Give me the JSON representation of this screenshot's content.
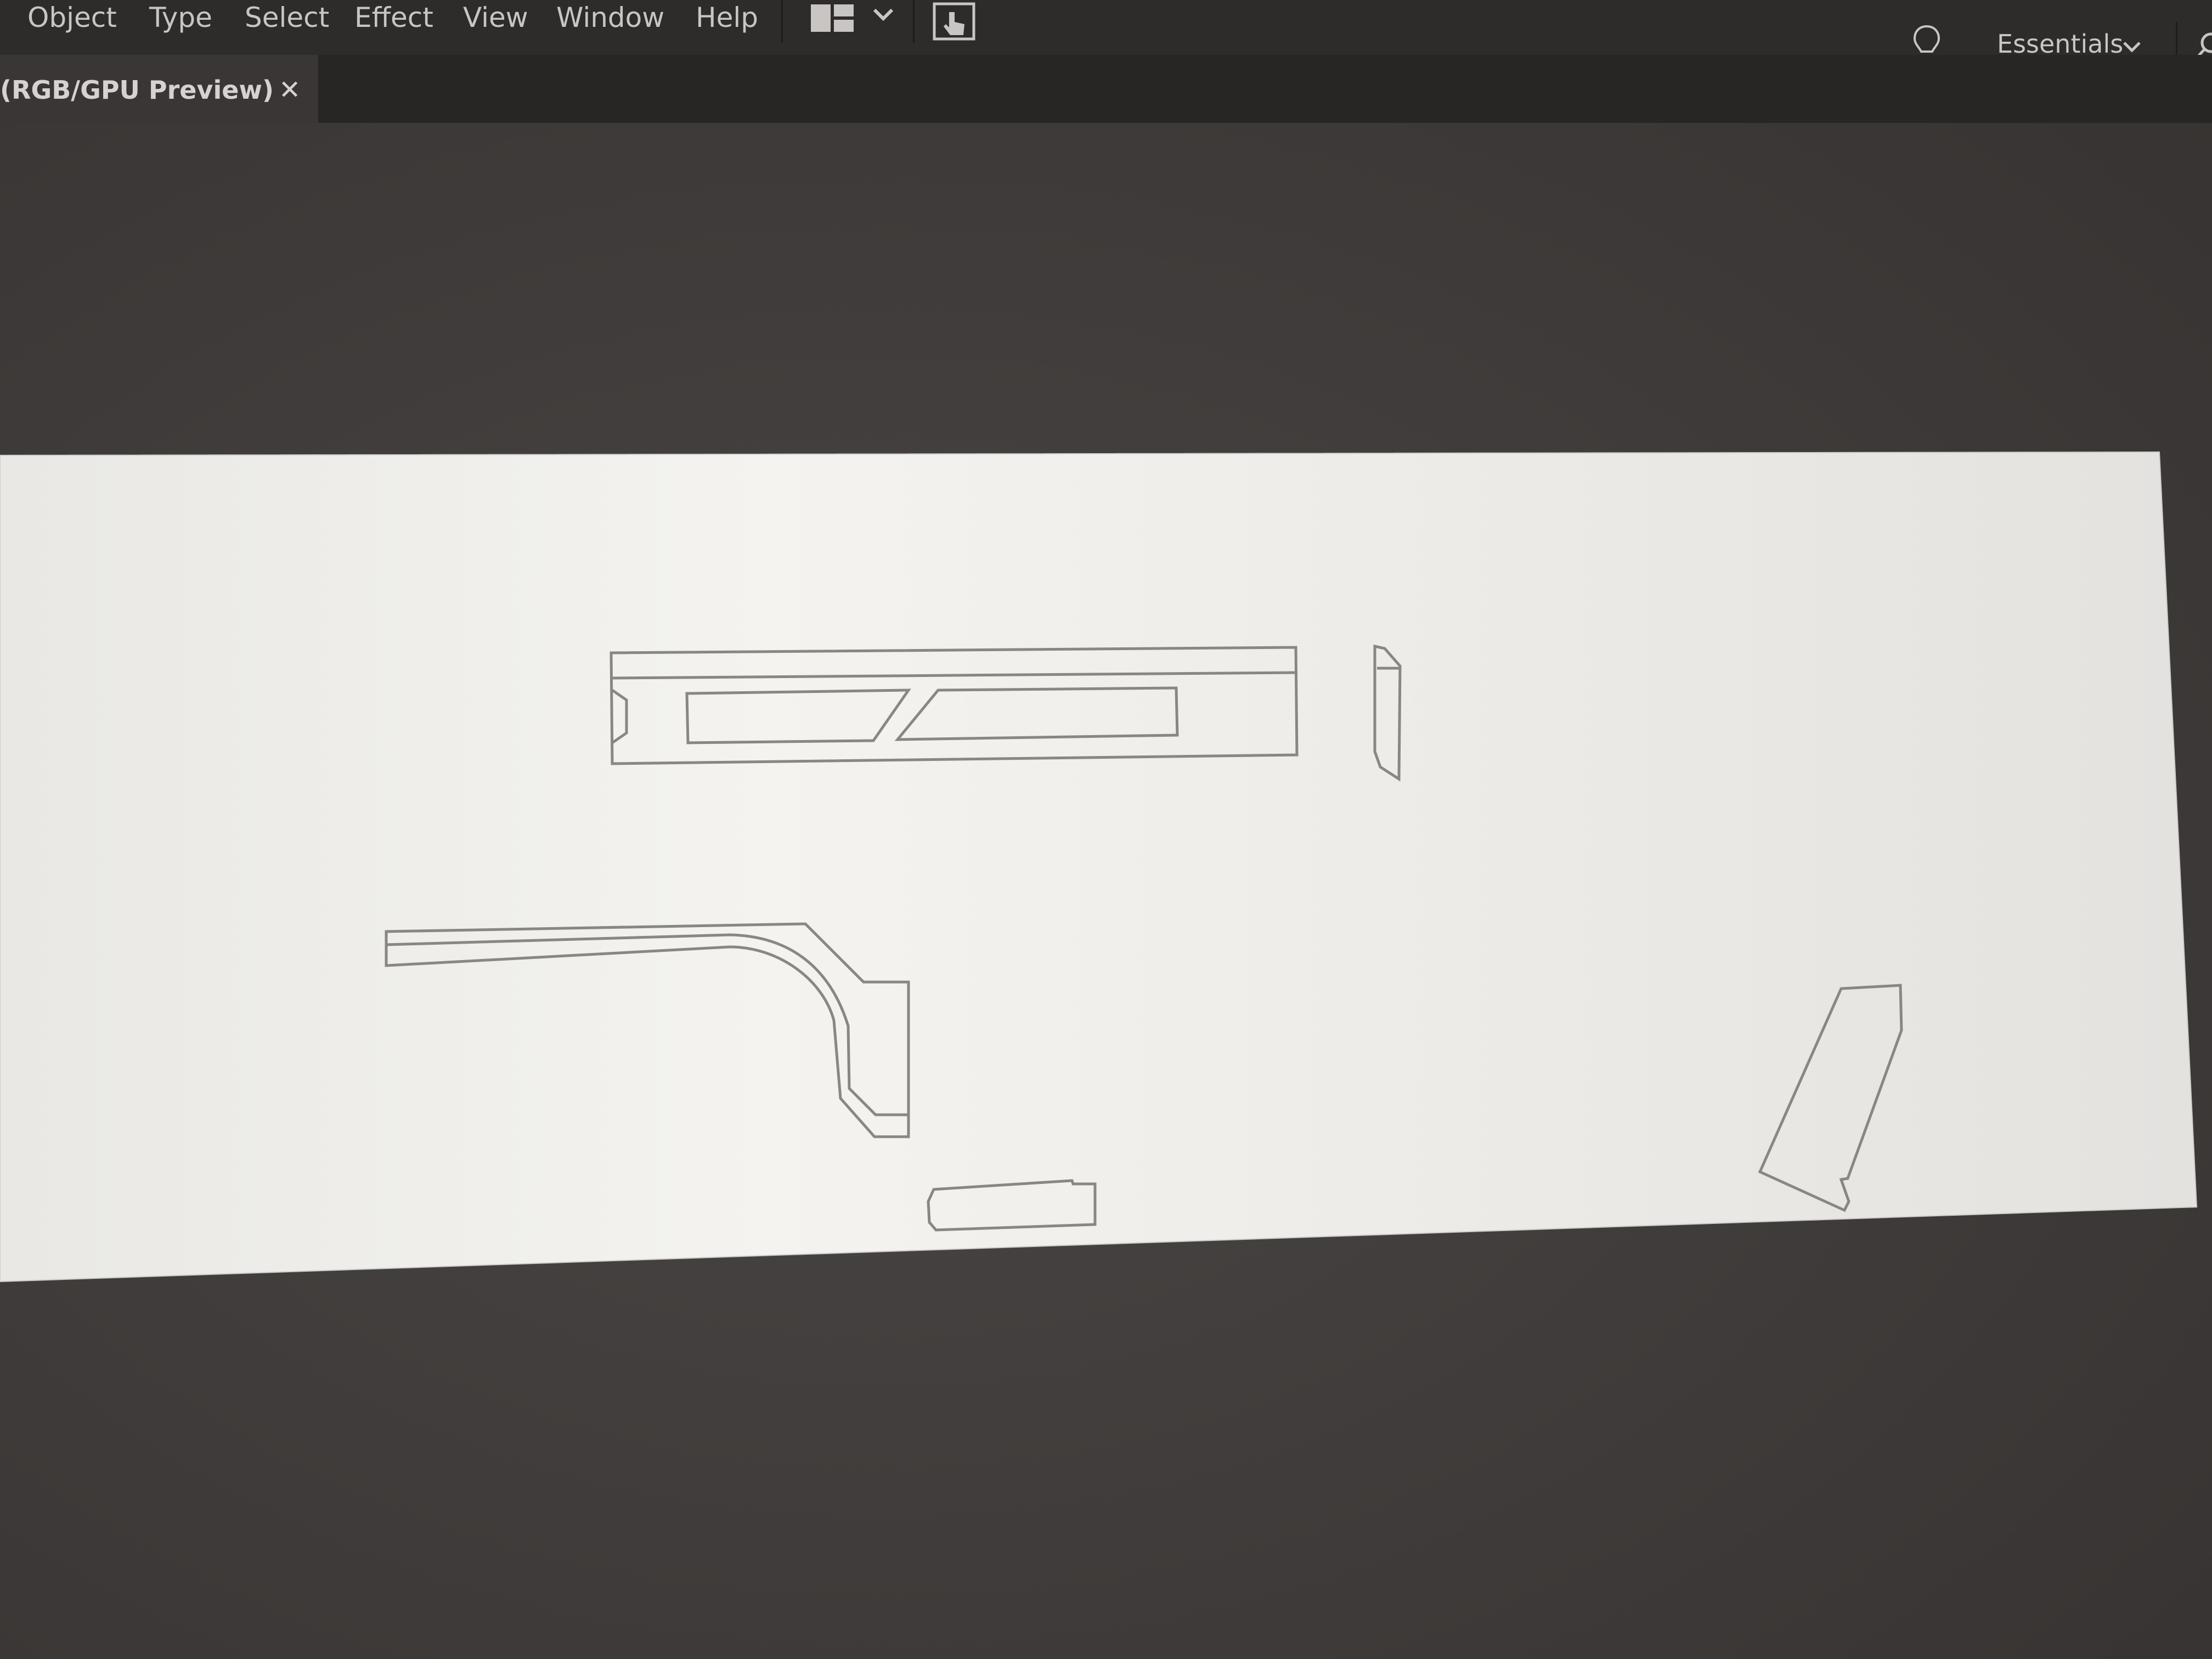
{
  "menu": {
    "items": [
      {
        "label": "Object"
      },
      {
        "label": "Type"
      },
      {
        "label": "Select"
      },
      {
        "label": "Effect"
      },
      {
        "label": "View"
      },
      {
        "label": "Window"
      },
      {
        "label": "Help"
      }
    ],
    "layout_icon": "arrange-documents-icon",
    "gpu_icon": "gpu-performance-icon"
  },
  "toolbar_right": {
    "lightbulb_icon": "lightbulb-icon",
    "workspace": "Essentials",
    "search_icon": "search-icon"
  },
  "document_tab": {
    "title": "(RGB/GPU Preview)",
    "close_icon": "✕"
  },
  "colors": {
    "menubar_bg": "#2e2b2b",
    "canvas_bg": "#413d3c",
    "artboard_bg": "#ecebe8",
    "stroke": "#8a8683"
  }
}
